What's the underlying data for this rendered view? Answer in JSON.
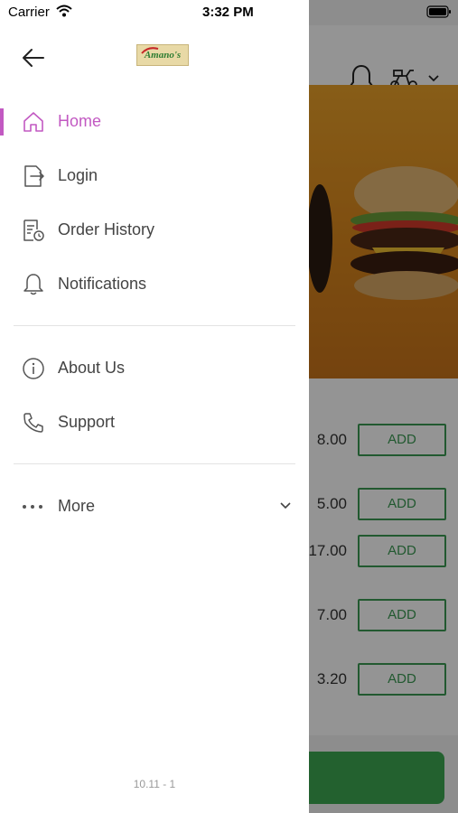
{
  "status_bar": {
    "carrier": "Carrier",
    "time": "3:32 PM"
  },
  "drawer": {
    "logo_text": "Amano's",
    "menu": [
      {
        "id": "home",
        "label": "Home",
        "icon": "home-icon",
        "active": true
      },
      {
        "id": "login",
        "label": "Login",
        "icon": "login-icon",
        "active": false
      },
      {
        "id": "order-history",
        "label": "Order History",
        "icon": "order-history-icon",
        "active": false
      },
      {
        "id": "notifications",
        "label": "Notifications",
        "icon": "bell-icon",
        "active": false
      }
    ],
    "menu2": [
      {
        "id": "about-us",
        "label": "About Us",
        "icon": "info-icon"
      },
      {
        "id": "support",
        "label": "Support",
        "icon": "phone-icon"
      }
    ],
    "more_label": "More",
    "version": "10.11 - 1",
    "accent_color": "#c259c2"
  },
  "background": {
    "items": [
      {
        "price": "8.00",
        "button": "ADD"
      },
      {
        "price": "5.00",
        "button": "ADD"
      },
      {
        "price": "17.00",
        "button": "ADD"
      },
      {
        "price": "7.00",
        "button": "ADD"
      },
      {
        "price": "3.20",
        "button": "ADD"
      }
    ],
    "brand_green": "#3b9a53"
  }
}
